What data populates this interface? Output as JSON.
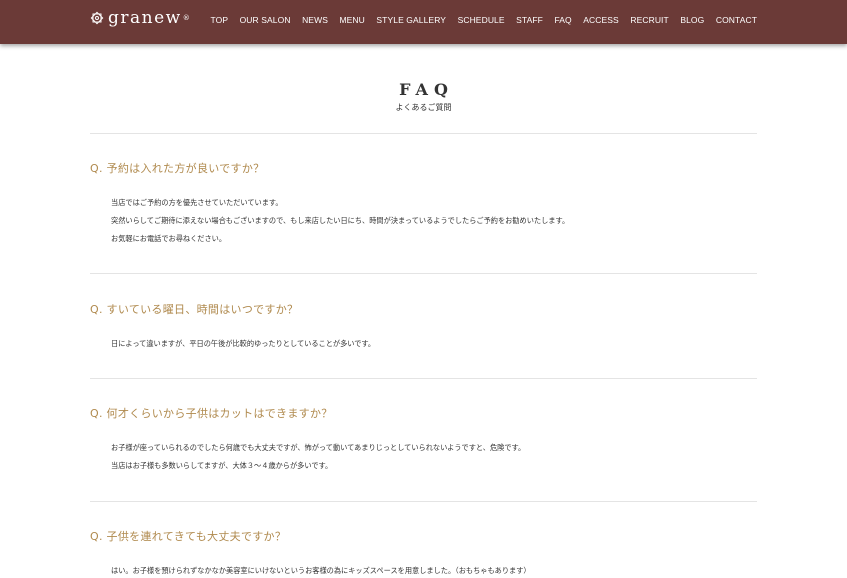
{
  "header": {
    "logo_text": "granew",
    "logo_sup": "®",
    "nav": [
      "TOP",
      "OUR SALON",
      "NEWS",
      "MENU",
      "STYLE GALLERY",
      "SCHEDULE",
      "STAFF",
      "FAQ",
      "ACCESS",
      "RECRUIT",
      "BLOG",
      "CONTACT"
    ]
  },
  "page": {
    "title": "FAQ",
    "subtitle": "よくあるご質問"
  },
  "faq": [
    {
      "question": "Q. 予約は入れた方が良いですか？",
      "answer": [
        "当店ではご予約の方を優先させていただいています。",
        "突然いらしてご期待に添えない場合もございますので、もし来店したい日にち、時間が決まっているようでしたらご予約をお勧めいたします。",
        "お気軽にお電話でお尋ねください。"
      ]
    },
    {
      "question": "Q. すいている曜日、時間はいつですか？",
      "answer": [
        "日によって違いますが、平日の午後が比較的ゆったりとしていることが多いです。"
      ]
    },
    {
      "question": "Q. 何才くらいから子供はカットはできますか？",
      "answer": [
        "お子様が座っていられるのでしたら何歳でも大丈夫ですが、怖がって動いてあまりじっとしていられないようですと、危険です。",
        "当店はお子様も多数いらしてますが、大体３〜４歳からが多いです。"
      ]
    },
    {
      "question": "Q. 子供を連れてきても大丈夫ですか？",
      "answer": [
        "はい。お子様を預けられずなかなか美容室にいけないというお客様の為にキッズスペースを用意しました。（おもちゃもあります）"
      ]
    }
  ]
}
